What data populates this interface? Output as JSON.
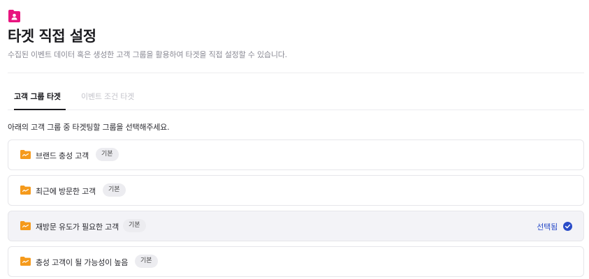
{
  "header": {
    "icon": "user-folder-icon",
    "title": "타겟 직접 설정",
    "subtitle": "수집된 이벤트 데이터 혹은 생성한 고객 그룹을 활용하여 타겟을 직접 설정할 수 있습니다."
  },
  "tabs": [
    {
      "label": "고객 그룹 타겟",
      "active": true
    },
    {
      "label": "이벤트 조건 타겟",
      "active": false
    }
  ],
  "instruction": "아래의 고객 그룹 중 타겟팅할 그룹을 선택해주세요.",
  "groups": [
    {
      "label": "브랜드 충성 고객",
      "badge": "기본",
      "selected": false
    },
    {
      "label": "최근에 방문한 고객",
      "badge": "기본",
      "selected": false
    },
    {
      "label": "재방문 유도가 필요한 고객",
      "badge": "기본",
      "selected": true
    },
    {
      "label": "충성 고객이 될 가능성이 높음",
      "badge": "기본",
      "selected": false
    }
  ],
  "selected_label": "선택됨",
  "colors": {
    "brand": "#e8157f",
    "folder": "#f59a1c",
    "selected_text": "#2a4cc8",
    "check": "#2a4cc8"
  }
}
